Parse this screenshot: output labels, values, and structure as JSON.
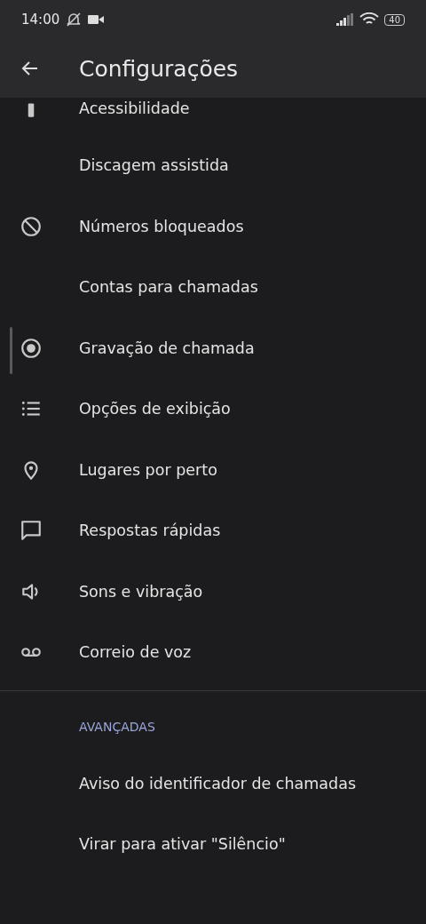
{
  "status_bar": {
    "time": "14:00"
  },
  "toolbar": {
    "title": "Configurações"
  },
  "items": [
    {
      "label": "Acessibilidade"
    },
    {
      "label": "Discagem assistida"
    },
    {
      "label": "Números bloqueados"
    },
    {
      "label": "Contas para chamadas"
    },
    {
      "label": "Gravação de chamada"
    },
    {
      "label": "Opções de exibição"
    },
    {
      "label": "Lugares por perto"
    },
    {
      "label": "Respostas rápidas"
    },
    {
      "label": "Sons e vibração"
    },
    {
      "label": "Correio de voz"
    }
  ],
  "advanced": {
    "header": "AVANÇADAS",
    "items": [
      {
        "label": "Aviso do identificador de chamadas"
      },
      {
        "label": "Virar para ativar \"Silêncio\""
      }
    ]
  },
  "battery": "40"
}
